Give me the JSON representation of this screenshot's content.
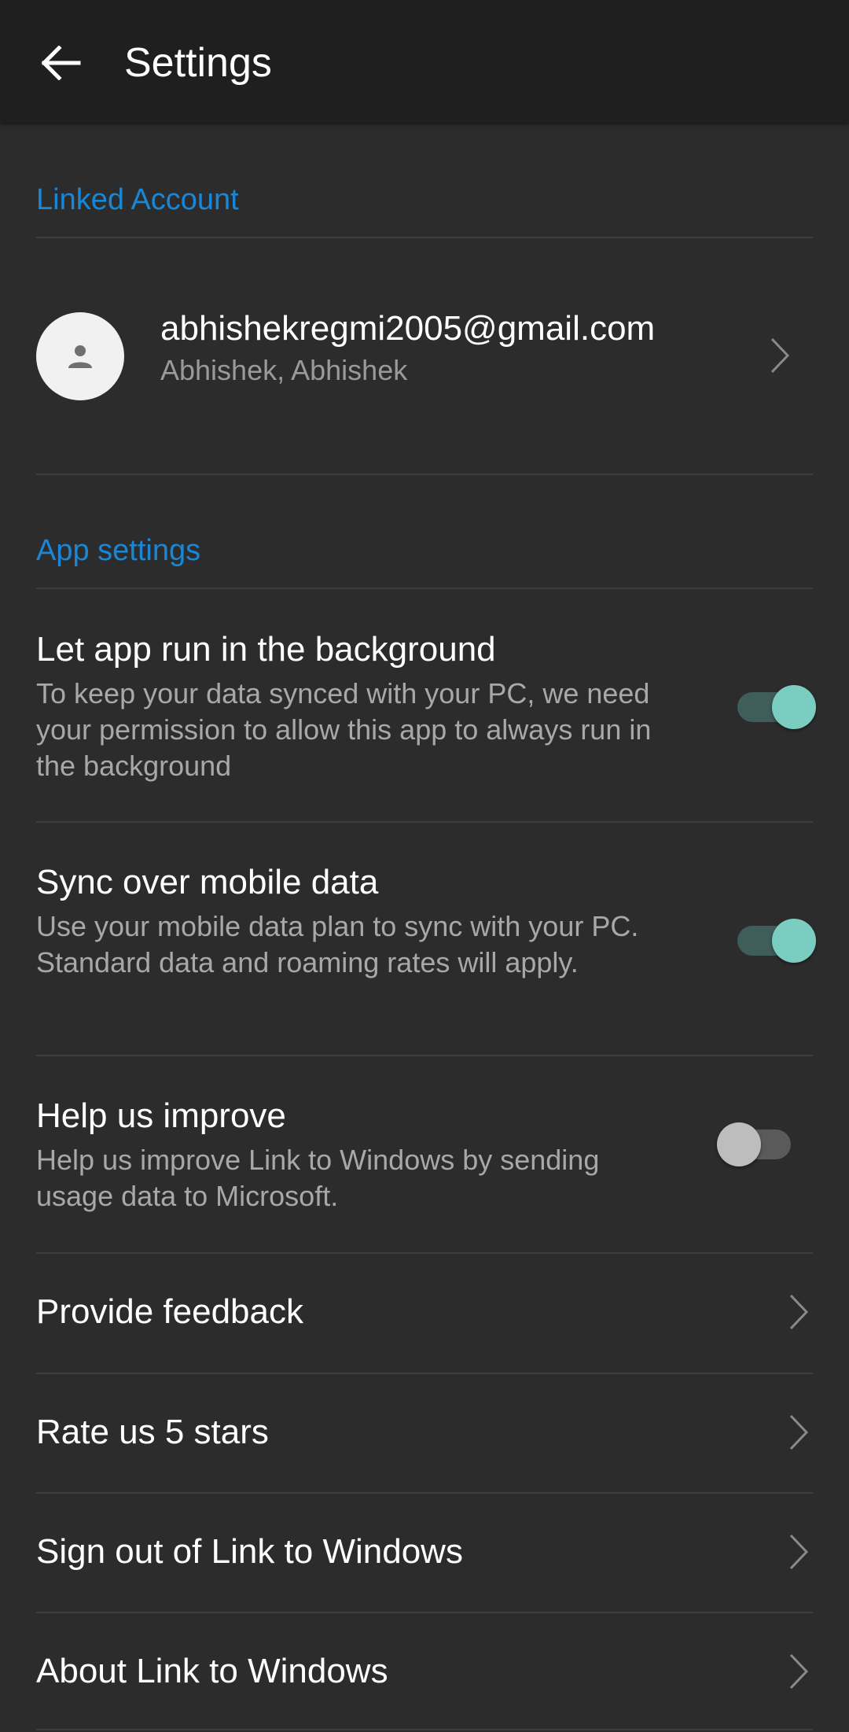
{
  "appbar": {
    "title": "Settings",
    "back_icon": "arrow-left-icon"
  },
  "linked_account": {
    "header": "Linked Account",
    "email": "abhishekregmi2005@gmail.com",
    "name": "Abhishek, Abhishek",
    "avatar_icon": "person-icon"
  },
  "app_settings": {
    "header": "App settings",
    "items": [
      {
        "title": "Let app run in the background",
        "description": "To keep your data synced with your PC, we need your permission to allow this app to always run in the background",
        "enabled": true
      },
      {
        "title": "Sync over mobile data",
        "description": "Use your mobile data plan to sync with your PC. Standard data and roaming rates will apply.",
        "enabled": true
      },
      {
        "title": "Help us improve",
        "description": "Help us improve Link to Windows by sending usage data to Microsoft.",
        "enabled": false
      }
    ]
  },
  "links": [
    {
      "label": "Provide feedback"
    },
    {
      "label": "Rate us 5 stars"
    },
    {
      "label": "Sign out of Link to Windows"
    },
    {
      "label": "About Link to Windows"
    }
  ],
  "colors": {
    "background": "#2c2c2c",
    "appbar": "#1f1f1f",
    "accent": "#1a86d6",
    "toggle_on_thumb": "#7ccdc1",
    "toggle_on_track": "#3f5d59",
    "toggle_off_thumb": "#bdbdbd"
  }
}
